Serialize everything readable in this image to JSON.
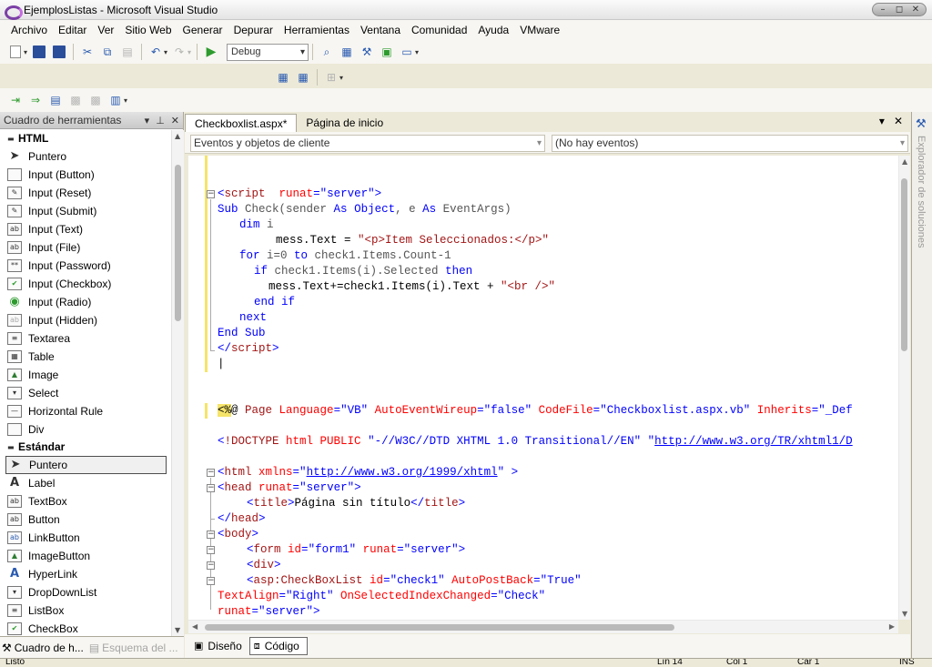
{
  "window": {
    "title": "EjemplosListas - Microsoft Visual Studio"
  },
  "menu": [
    "Archivo",
    "Editar",
    "Ver",
    "Sitio Web",
    "Generar",
    "Depurar",
    "Herramientas",
    "Ventana",
    "Comunidad",
    "Ayuda",
    "VMware"
  ],
  "toolbar": {
    "config": "Debug"
  },
  "toolbox": {
    "title": "Cuadro de herramientas",
    "groups": [
      {
        "label": "HTML",
        "items": [
          "Puntero",
          "Input (Button)",
          "Input (Reset)",
          "Input (Submit)",
          "Input (Text)",
          "Input (File)",
          "Input (Password)",
          "Input (Checkbox)",
          "Input (Radio)",
          "Input (Hidden)",
          "Textarea",
          "Table",
          "Image",
          "Select",
          "Horizontal Rule",
          "Div"
        ]
      },
      {
        "label": "Estándar",
        "items": [
          "Puntero",
          "Label",
          "TextBox",
          "Button",
          "LinkButton",
          "ImageButton",
          "HyperLink",
          "DropDownList",
          "ListBox",
          "CheckBox"
        ]
      }
    ]
  },
  "left_tabs": [
    "Cuadro de h...",
    "Esquema del ..."
  ],
  "editor": {
    "tabs": [
      "Checkboxlist.aspx*",
      "Página de inicio"
    ],
    "combo_left": "Eventos y objetos de cliente",
    "combo_right": "(No hay eventos)",
    "view_tabs": [
      "Diseño",
      "Código"
    ]
  },
  "right_strip": {
    "label": "Explorador de soluciones"
  },
  "code": {
    "l1_tag": "script",
    "l1_attr": "runat",
    "l1_val": "\"server\"",
    "l2_kw1": "Sub",
    "l2_a": " Check(sender ",
    "l2_kw2": "As",
    "l2_kw3": "Object",
    "l2_b": ", e ",
    "l2_kw4": "As",
    "l2_c": " EventArgs)",
    "l3_kw": "dim",
    "l3_a": " i",
    "l4_a": "mess.Text = ",
    "l4_str": "\"<p>Item Seleccionados:</p>\"",
    "l5_kw1": "for",
    "l5_a": " i=0 ",
    "l5_kw2": "to",
    "l5_b": " check1.Items.Count-1",
    "l6_kw1": "if",
    "l6_a": " check1.Items(i).Selected ",
    "l6_kw2": "then",
    "l7_a": "mess.Text+=check1.Items(i).Text + ",
    "l7_str": "\"<br />\"",
    "l8_kw": "end if",
    "l9_kw": "next",
    "l10_kw": "End Sub",
    "l11_tag": "script",
    "l12_hl": "<%",
    "l12_a": "@ ",
    "l12_b": "Page ",
    "l12_c": "Language",
    "l12_d": "=",
    "l12_e": "\"VB\" ",
    "l12_f": "AutoEventWireup",
    "l12_g": "\"false\" ",
    "l12_h": "CodeFile",
    "l12_i": "\"Checkboxlist.aspx.vb\" ",
    "l12_j": "Inherits",
    "l12_k": "\"_Def",
    "l13_a": "!DOCTYPE ",
    "l13_b": "html ",
    "l13_c": "PUBLIC ",
    "l13_d": "\"-//W3C//DTD XHTML 1.0 Transitional//EN\" ",
    "l13_e": "\"",
    "l13_link": "http://www.w3.org/TR/xhtml1/D",
    "l14_tag": "html",
    "l14_attr": " xmlns",
    "l14_link": "http://www.w3.org/1999/xhtml",
    "l15_tag": "head",
    "l15_attr": " runat",
    "l15_val": "\"server\"",
    "l16_tag": "title",
    "l16_text": "Página sin título",
    "l17_tag": "head",
    "l18_tag": "body",
    "l19_tag": "form",
    "l19_attr1": " id",
    "l19_val1": "\"form1\"",
    "l19_attr2": " runat",
    "l19_val2": "\"server\"",
    "l20_tag": "div",
    "l21_tag": "asp:CheckBoxList",
    "l21_attr1": " id",
    "l21_val1": "\"check1\"",
    "l21_attr2": " AutoPostBack",
    "l21_val2": "\"True\"",
    "l22_attr1": "TextAlign",
    "l22_val1": "\"Right\"",
    "l22_attr2": " OnSelectedIndexChanged",
    "l22_val2": "\"Check\"",
    "l23_attr": "runat",
    "l23_val": "\"server\""
  },
  "status": {
    "left": "Listo",
    "ln": "Lín 14",
    "col": "Col 1",
    "car": "Car 1",
    "ins": "INS"
  }
}
